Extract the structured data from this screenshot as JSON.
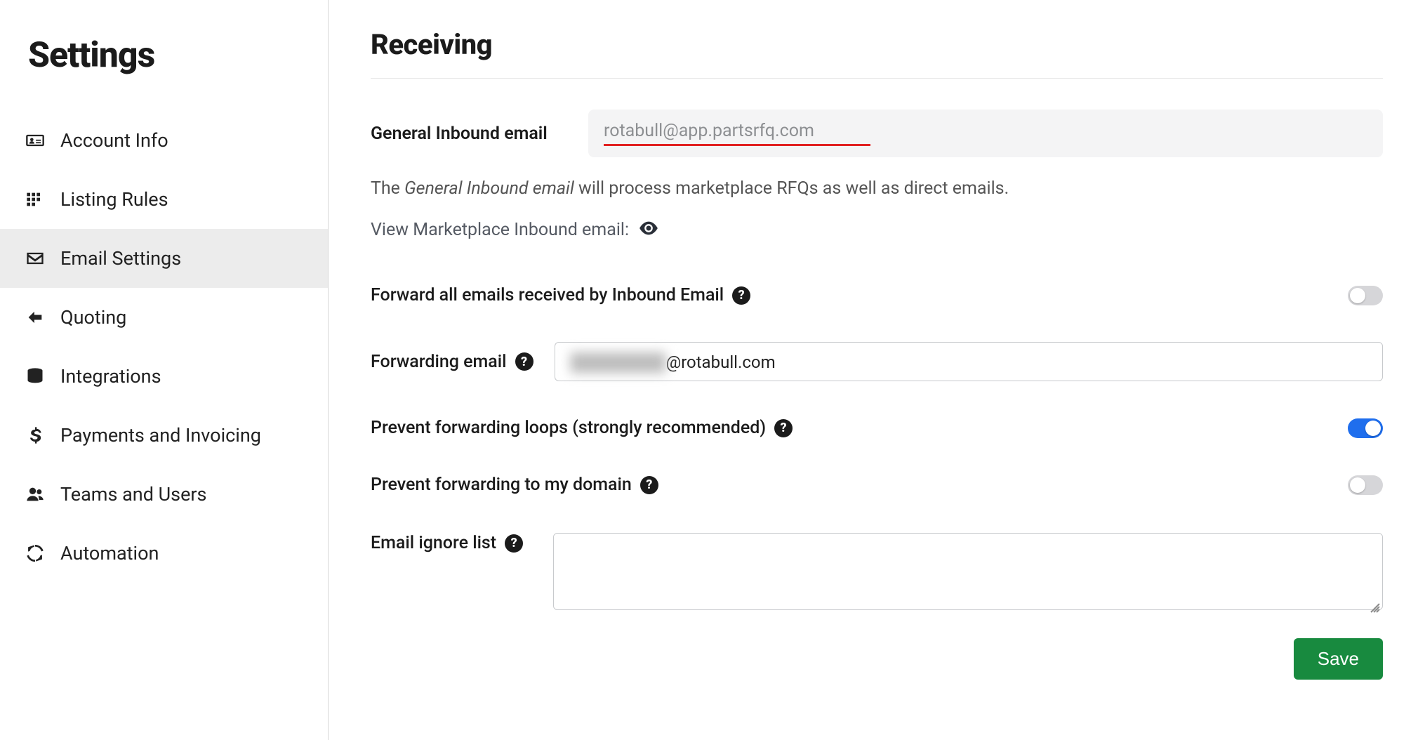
{
  "sidebar": {
    "title": "Settings",
    "items": [
      {
        "label": "Account Info"
      },
      {
        "label": "Listing Rules"
      },
      {
        "label": "Email Settings"
      },
      {
        "label": "Quoting"
      },
      {
        "label": "Integrations"
      },
      {
        "label": "Payments and Invoicing"
      },
      {
        "label": "Teams and Users"
      },
      {
        "label": "Automation"
      }
    ]
  },
  "main": {
    "title": "Receiving",
    "general_inbound_label": "General Inbound email",
    "general_inbound_value": "rotabull@app.partsrfq.com",
    "desc_prefix": "The ",
    "desc_em": "General Inbound email",
    "desc_suffix": " will process marketplace RFQs as well as direct emails.",
    "view_marketplace_label": "View Marketplace Inbound email:",
    "forward_all_label": "Forward all emails received by Inbound Email",
    "forward_all_state": "off",
    "forwarding_email_label": "Forwarding email",
    "forwarding_email_blurred": " ",
    "forwarding_email_visible": "@rotabull.com",
    "prevent_loops_label": "Prevent forwarding loops (strongly recommended)",
    "prevent_loops_state": "on",
    "prevent_domain_label": "Prevent forwarding to my domain",
    "prevent_domain_state": "off",
    "ignore_list_label": "Email ignore list",
    "ignore_list_value": "",
    "save_label": "Save"
  }
}
